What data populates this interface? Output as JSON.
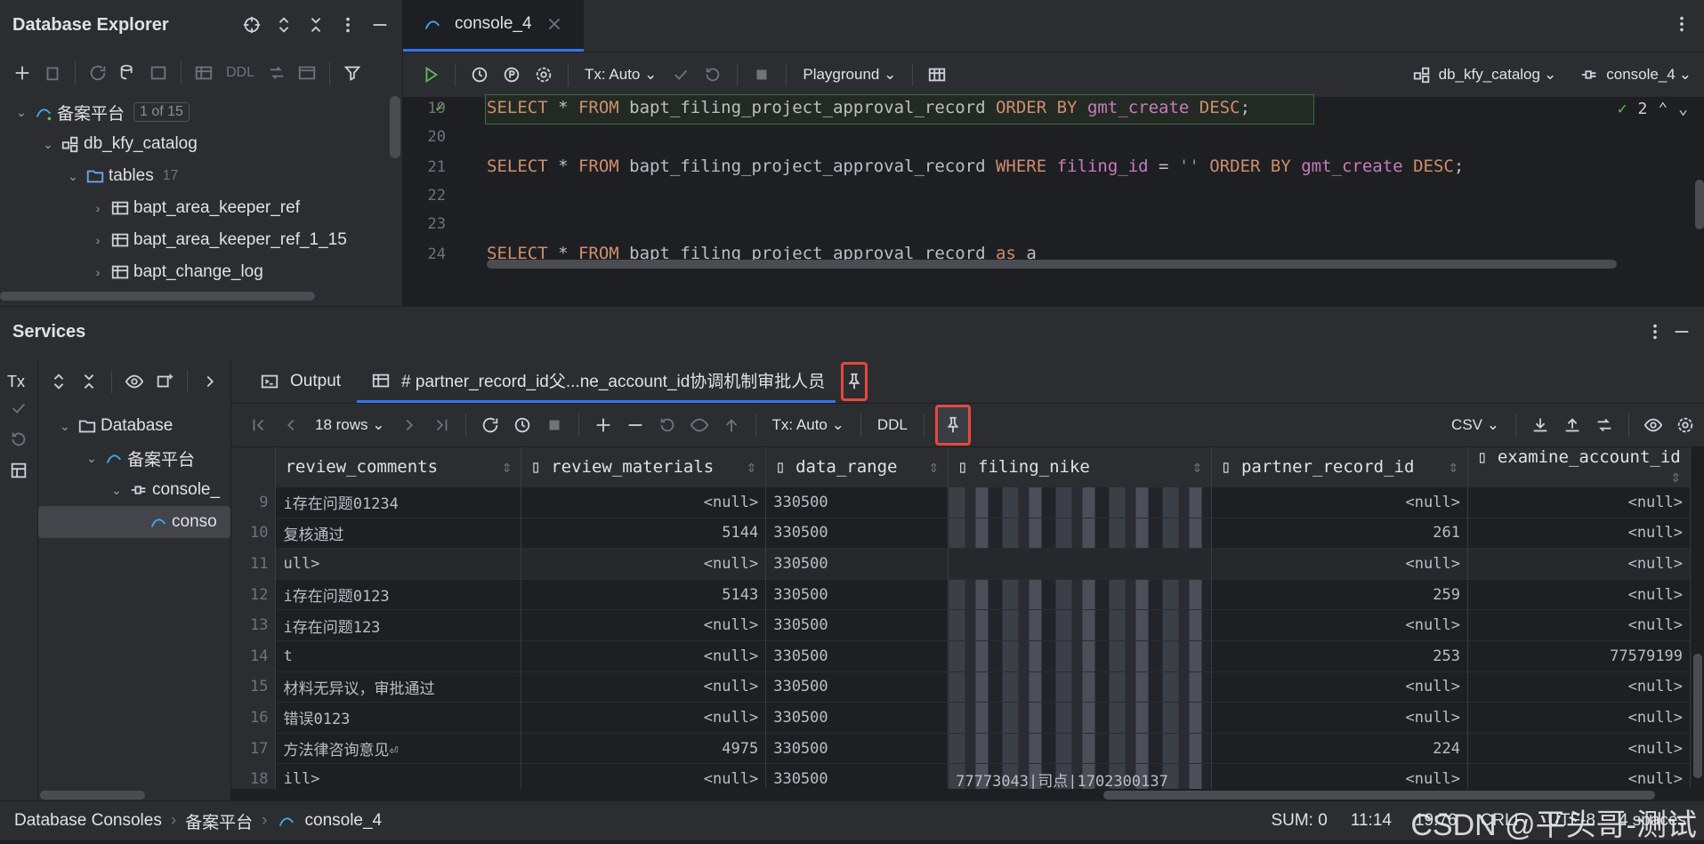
{
  "db_explorer": {
    "title": "Database Explorer",
    "toolbar_ddl": "DDL",
    "tree": [
      {
        "label": "备案平台",
        "badge": "1 of 15"
      },
      {
        "label": "db_kfy_catalog"
      },
      {
        "label": "tables",
        "count": "17"
      },
      {
        "label": "bapt_area_keeper_ref"
      },
      {
        "label": "bapt_area_keeper_ref_1_15"
      },
      {
        "label": "bapt_change_log"
      }
    ]
  },
  "editor": {
    "tab_label": "console_4",
    "tx_label": "Tx: Auto",
    "playground_label": "Playground",
    "datasource": "db_kfy_catalog",
    "session": "console_4",
    "check_count": "2",
    "lines": [
      {
        "num": "19",
        "parts": [
          [
            "kw",
            "SELECT"
          ],
          [
            "id",
            " * "
          ],
          [
            "kw",
            "FROM"
          ],
          [
            "id",
            " bapt_filing_project_approval_record "
          ],
          [
            "kw",
            "ORDER BY"
          ],
          [
            "id",
            " "
          ],
          [
            "fld",
            "gmt_create"
          ],
          [
            "id",
            " "
          ],
          [
            "kw",
            "DESC"
          ],
          [
            "id",
            ";"
          ]
        ]
      },
      {
        "num": "20",
        "parts": []
      },
      {
        "num": "21",
        "parts": [
          [
            "kw",
            "SELECT"
          ],
          [
            "id",
            " * "
          ],
          [
            "kw",
            "FROM"
          ],
          [
            "id",
            " bapt_filing_project_approval_record "
          ],
          [
            "kw",
            "WHERE"
          ],
          [
            "id",
            " "
          ],
          [
            "fld",
            "filing_id"
          ],
          [
            "id",
            " = "
          ],
          [
            "str",
            "''"
          ],
          [
            "id",
            " "
          ],
          [
            "kw",
            "ORDER BY"
          ],
          [
            "id",
            " "
          ],
          [
            "fld",
            "gmt_create"
          ],
          [
            "id",
            " "
          ],
          [
            "kw",
            "DESC"
          ],
          [
            "id",
            ";"
          ]
        ]
      },
      {
        "num": "22",
        "parts": []
      },
      {
        "num": "23",
        "parts": []
      },
      {
        "num": "24",
        "parts": [
          [
            "kw",
            "SELECT"
          ],
          [
            "id",
            " * "
          ],
          [
            "kw",
            "FROM"
          ],
          [
            "id",
            " bapt_filing_project_approval_record "
          ],
          [
            "kw",
            "as"
          ],
          [
            "id",
            " a"
          ]
        ]
      }
    ]
  },
  "services": {
    "title": "Services",
    "tree": [
      {
        "label": "Database"
      },
      {
        "label": "备案平台"
      },
      {
        "label": "console_"
      },
      {
        "label": "conso"
      }
    ],
    "tabs": {
      "output": "Output",
      "result": "# partner_record_id父...ne_account_id协调机制审批人员"
    },
    "toolbar": {
      "rows": "18 rows",
      "tx": "Tx: Auto",
      "ddl": "DDL",
      "export": "CSV"
    },
    "columns": [
      "review_comments",
      "review_materials",
      "data_range",
      "filing_nike",
      "partner_record_id",
      "examine_account_id"
    ],
    "rows": [
      {
        "n": "9",
        "c1": "i存在问题01234",
        "c2": "<null>",
        "c3": "330500",
        "c4": "",
        "c5": "<null>",
        "c6": "<null>"
      },
      {
        "n": "10",
        "c1": "复核通过",
        "c2": "5144",
        "c3": "330500",
        "c4": "",
        "c5": "261",
        "c6": "<null>"
      },
      {
        "n": "11",
        "c1": "ull>",
        "c2": "<null>",
        "c3": "330500",
        "c4": "",
        "c5": "<null>",
        "c6": "<null>"
      },
      {
        "n": "12",
        "c1": "i存在问题0123",
        "c2": "5143",
        "c3": "330500",
        "c4": "",
        "c5": "259",
        "c6": "<null>"
      },
      {
        "n": "13",
        "c1": "i存在问题123",
        "c2": "<null>",
        "c3": "330500",
        "c4": "",
        "c5": "<null>",
        "c6": "<null>"
      },
      {
        "n": "14",
        "c1": "t",
        "c2": "<null>",
        "c3": "330500",
        "c4": "",
        "c5": "253",
        "c6": "77579199"
      },
      {
        "n": "15",
        "c1": "材料无异议，审批通过",
        "c2": "<null>",
        "c3": "330500",
        "c4": "",
        "c5": "<null>",
        "c6": "<null>"
      },
      {
        "n": "16",
        "c1": "错误0123",
        "c2": "<null>",
        "c3": "330500",
        "c4": "",
        "c5": "<null>",
        "c6": "<null>"
      },
      {
        "n": "17",
        "c1": "方法律咨询意见⏎",
        "c2": "4975",
        "c3": "330500",
        "c4": "",
        "c5": "224",
        "c6": "<null>"
      },
      {
        "n": "18",
        "c1": "ill>",
        "c2": "<null>",
        "c3": "330500",
        "c4": "77773043|司点|1702300137",
        "c5": "<null>",
        "c6": "<null>"
      }
    ]
  },
  "status": {
    "breadcrumb": [
      "Database Consoles",
      "备案平台",
      "console_4"
    ],
    "sum": "SUM: 0",
    "pos": "11:14",
    "sel": "19:76",
    "eol": "CRLF",
    "enc": "UTF-8",
    "indent": "4 spaces",
    "watermark": "CSDN @平头哥-测试"
  },
  "colors": {
    "accent": "#3574f0",
    "highlight": "#e5483d"
  }
}
